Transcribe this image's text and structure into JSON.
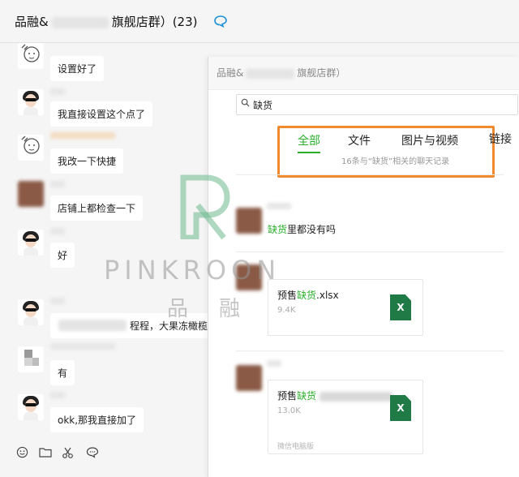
{
  "window": {
    "title_prefix": "品融&",
    "title_suffix": "旗舰店群）(23)",
    "title_icon": "chat-bubble-icon"
  },
  "chat": {
    "messages": [
      {
        "text": "设置好了",
        "avatar": "sketch-avatar"
      },
      {
        "text": "我直接设置这个点了",
        "avatar": "girl-sunglasses-avatar"
      },
      {
        "text": "我改一下快捷",
        "avatar": "sketch-avatar"
      },
      {
        "text": "店铺上都检查一下",
        "avatar": "pixelated-avatar"
      },
      {
        "text": "好",
        "avatar": "girl-sunglasses-avatar"
      },
      {
        "text": "程程，大果冻橄榄",
        "avatar": "girl-sunglasses-avatar"
      },
      {
        "text": "有",
        "avatar": "pixelated-avatar"
      },
      {
        "text": "okk,那我直接加了",
        "avatar": "girl-sunglasses-avatar"
      }
    ],
    "toolbar": [
      "emoji-icon",
      "folder-icon",
      "scissors-icon",
      "speech-bubble-icon"
    ]
  },
  "search_panel": {
    "title_prefix": "品融&",
    "title_suffix": "旗舰店群）",
    "search_value": "缺货",
    "tabs": [
      "全部",
      "文件",
      "图片与视频",
      "链接"
    ],
    "active_tab": "全部",
    "result_summary": "16条与“缺货”相关的聊天记录",
    "results": [
      {
        "type": "text",
        "highlight": "缺货",
        "rest": "里都没有吗"
      },
      {
        "type": "file",
        "prefix": "预售",
        "highlight": "缺货",
        "suffix": ".xlsx",
        "size": "9.4K",
        "icon": "excel-file-icon"
      },
      {
        "type": "file",
        "prefix": "预售",
        "highlight": "缺货",
        "suffix": "",
        "size": "13.0K",
        "icon": "excel-file-icon",
        "footer": "微信电脑版"
      }
    ]
  },
  "watermark": {
    "brand": "PINKROON",
    "chars": [
      "品",
      "融"
    ]
  },
  "colors": {
    "accent_green": "#2aae2a",
    "highlight_orange": "#f28a2c",
    "excel_green": "#1f7a45"
  }
}
